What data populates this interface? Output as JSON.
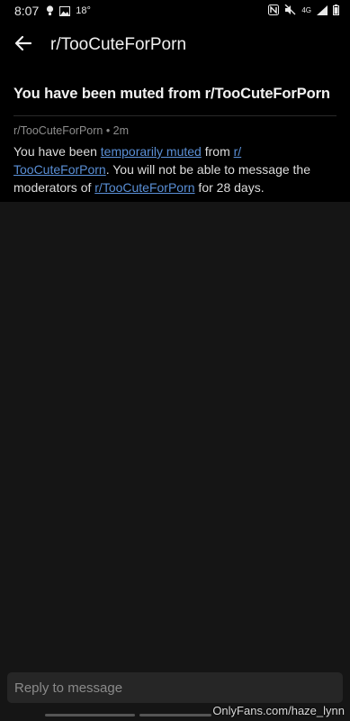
{
  "status_bar": {
    "time": "8:07",
    "temperature": "18°",
    "icons": [
      "lightbulb-icon",
      "image-icon",
      "nfc-icon",
      "mute-icon",
      "4g-icon",
      "signal-icon",
      "battery-icon"
    ],
    "network": "4G"
  },
  "app_bar": {
    "back_icon": "arrow-left-icon",
    "title": "r/TooCuteForPorn"
  },
  "message": {
    "subject": "You have been muted from r/TooCuteForPorn",
    "meta": "r/TooCuteForPorn • 2m",
    "body": {
      "t1": "You have been ",
      "link1": "temporarily muted",
      "t2": " from ",
      "link2": "r/ TooCuteForPorn",
      "t3": ". You will not be able to message the moderators of ",
      "link3": "r/TooCuteForPorn",
      "t4": " for 28 days."
    }
  },
  "reply": {
    "placeholder": "Reply to message",
    "value": ""
  },
  "watermark": "OnlyFans.com/haze_lynn",
  "colors": {
    "background": "#151515",
    "card": "#000000",
    "link": "#5a8fd6",
    "reply_field": "#262626"
  }
}
